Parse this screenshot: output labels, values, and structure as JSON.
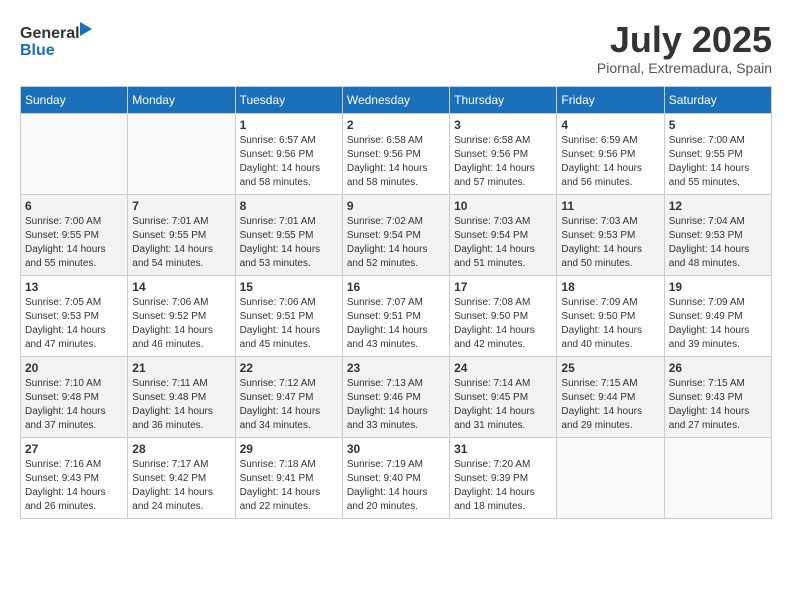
{
  "header": {
    "logo_line1": "General",
    "logo_line2": "Blue",
    "month_year": "July 2025",
    "location": "Piornal, Extremadura, Spain"
  },
  "weekdays": [
    "Sunday",
    "Monday",
    "Tuesday",
    "Wednesday",
    "Thursday",
    "Friday",
    "Saturday"
  ],
  "weeks": [
    [
      {
        "day": "",
        "sunrise": "",
        "sunset": "",
        "daylight": ""
      },
      {
        "day": "",
        "sunrise": "",
        "sunset": "",
        "daylight": ""
      },
      {
        "day": "1",
        "sunrise": "Sunrise: 6:57 AM",
        "sunset": "Sunset: 9:56 PM",
        "daylight": "Daylight: 14 hours and 58 minutes."
      },
      {
        "day": "2",
        "sunrise": "Sunrise: 6:58 AM",
        "sunset": "Sunset: 9:56 PM",
        "daylight": "Daylight: 14 hours and 58 minutes."
      },
      {
        "day": "3",
        "sunrise": "Sunrise: 6:58 AM",
        "sunset": "Sunset: 9:56 PM",
        "daylight": "Daylight: 14 hours and 57 minutes."
      },
      {
        "day": "4",
        "sunrise": "Sunrise: 6:59 AM",
        "sunset": "Sunset: 9:56 PM",
        "daylight": "Daylight: 14 hours and 56 minutes."
      },
      {
        "day": "5",
        "sunrise": "Sunrise: 7:00 AM",
        "sunset": "Sunset: 9:55 PM",
        "daylight": "Daylight: 14 hours and 55 minutes."
      }
    ],
    [
      {
        "day": "6",
        "sunrise": "Sunrise: 7:00 AM",
        "sunset": "Sunset: 9:55 PM",
        "daylight": "Daylight: 14 hours and 55 minutes."
      },
      {
        "day": "7",
        "sunrise": "Sunrise: 7:01 AM",
        "sunset": "Sunset: 9:55 PM",
        "daylight": "Daylight: 14 hours and 54 minutes."
      },
      {
        "day": "8",
        "sunrise": "Sunrise: 7:01 AM",
        "sunset": "Sunset: 9:55 PM",
        "daylight": "Daylight: 14 hours and 53 minutes."
      },
      {
        "day": "9",
        "sunrise": "Sunrise: 7:02 AM",
        "sunset": "Sunset: 9:54 PM",
        "daylight": "Daylight: 14 hours and 52 minutes."
      },
      {
        "day": "10",
        "sunrise": "Sunrise: 7:03 AM",
        "sunset": "Sunset: 9:54 PM",
        "daylight": "Daylight: 14 hours and 51 minutes."
      },
      {
        "day": "11",
        "sunrise": "Sunrise: 7:03 AM",
        "sunset": "Sunset: 9:53 PM",
        "daylight": "Daylight: 14 hours and 50 minutes."
      },
      {
        "day": "12",
        "sunrise": "Sunrise: 7:04 AM",
        "sunset": "Sunset: 9:53 PM",
        "daylight": "Daylight: 14 hours and 48 minutes."
      }
    ],
    [
      {
        "day": "13",
        "sunrise": "Sunrise: 7:05 AM",
        "sunset": "Sunset: 9:53 PM",
        "daylight": "Daylight: 14 hours and 47 minutes."
      },
      {
        "day": "14",
        "sunrise": "Sunrise: 7:06 AM",
        "sunset": "Sunset: 9:52 PM",
        "daylight": "Daylight: 14 hours and 46 minutes."
      },
      {
        "day": "15",
        "sunrise": "Sunrise: 7:06 AM",
        "sunset": "Sunset: 9:51 PM",
        "daylight": "Daylight: 14 hours and 45 minutes."
      },
      {
        "day": "16",
        "sunrise": "Sunrise: 7:07 AM",
        "sunset": "Sunset: 9:51 PM",
        "daylight": "Daylight: 14 hours and 43 minutes."
      },
      {
        "day": "17",
        "sunrise": "Sunrise: 7:08 AM",
        "sunset": "Sunset: 9:50 PM",
        "daylight": "Daylight: 14 hours and 42 minutes."
      },
      {
        "day": "18",
        "sunrise": "Sunrise: 7:09 AM",
        "sunset": "Sunset: 9:50 PM",
        "daylight": "Daylight: 14 hours and 40 minutes."
      },
      {
        "day": "19",
        "sunrise": "Sunrise: 7:09 AM",
        "sunset": "Sunset: 9:49 PM",
        "daylight": "Daylight: 14 hours and 39 minutes."
      }
    ],
    [
      {
        "day": "20",
        "sunrise": "Sunrise: 7:10 AM",
        "sunset": "Sunset: 9:48 PM",
        "daylight": "Daylight: 14 hours and 37 minutes."
      },
      {
        "day": "21",
        "sunrise": "Sunrise: 7:11 AM",
        "sunset": "Sunset: 9:48 PM",
        "daylight": "Daylight: 14 hours and 36 minutes."
      },
      {
        "day": "22",
        "sunrise": "Sunrise: 7:12 AM",
        "sunset": "Sunset: 9:47 PM",
        "daylight": "Daylight: 14 hours and 34 minutes."
      },
      {
        "day": "23",
        "sunrise": "Sunrise: 7:13 AM",
        "sunset": "Sunset: 9:46 PM",
        "daylight": "Daylight: 14 hours and 33 minutes."
      },
      {
        "day": "24",
        "sunrise": "Sunrise: 7:14 AM",
        "sunset": "Sunset: 9:45 PM",
        "daylight": "Daylight: 14 hours and 31 minutes."
      },
      {
        "day": "25",
        "sunrise": "Sunrise: 7:15 AM",
        "sunset": "Sunset: 9:44 PM",
        "daylight": "Daylight: 14 hours and 29 minutes."
      },
      {
        "day": "26",
        "sunrise": "Sunrise: 7:15 AM",
        "sunset": "Sunset: 9:43 PM",
        "daylight": "Daylight: 14 hours and 27 minutes."
      }
    ],
    [
      {
        "day": "27",
        "sunrise": "Sunrise: 7:16 AM",
        "sunset": "Sunset: 9:43 PM",
        "daylight": "Daylight: 14 hours and 26 minutes."
      },
      {
        "day": "28",
        "sunrise": "Sunrise: 7:17 AM",
        "sunset": "Sunset: 9:42 PM",
        "daylight": "Daylight: 14 hours and 24 minutes."
      },
      {
        "day": "29",
        "sunrise": "Sunrise: 7:18 AM",
        "sunset": "Sunset: 9:41 PM",
        "daylight": "Daylight: 14 hours and 22 minutes."
      },
      {
        "day": "30",
        "sunrise": "Sunrise: 7:19 AM",
        "sunset": "Sunset: 9:40 PM",
        "daylight": "Daylight: 14 hours and 20 minutes."
      },
      {
        "day": "31",
        "sunrise": "Sunrise: 7:20 AM",
        "sunset": "Sunset: 9:39 PM",
        "daylight": "Daylight: 14 hours and 18 minutes."
      },
      {
        "day": "",
        "sunrise": "",
        "sunset": "",
        "daylight": ""
      },
      {
        "day": "",
        "sunrise": "",
        "sunset": "",
        "daylight": ""
      }
    ]
  ]
}
